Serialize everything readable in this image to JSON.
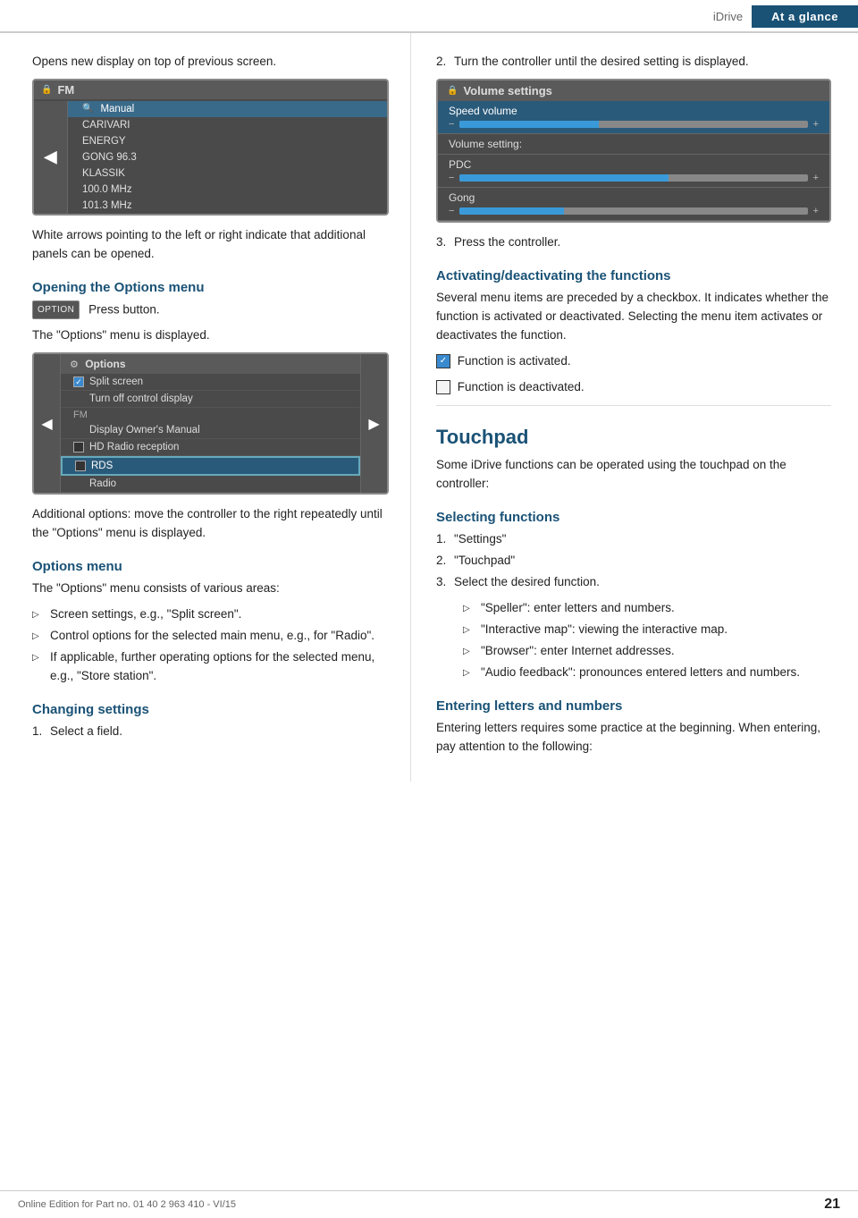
{
  "header": {
    "idrive_label": "iDrive",
    "ataglance_label": "At a glance"
  },
  "left_col": {
    "para1": "Opens new display on top of previous screen.",
    "screen1": {
      "header": "FM",
      "rows": [
        {
          "label": "Manual",
          "type": "search"
        },
        {
          "label": "CARIVARI",
          "type": "normal"
        },
        {
          "label": "ENERGY",
          "type": "normal"
        },
        {
          "label": "GONG 96.3",
          "type": "normal"
        },
        {
          "label": "KLASSIK",
          "type": "normal"
        },
        {
          "label": "100.0  MHz",
          "type": "normal"
        },
        {
          "label": "101.3  MHz",
          "type": "normal"
        }
      ]
    },
    "para2": "White arrows pointing to the left or right indicate that additional panels can be opened.",
    "opening_options": {
      "heading": "Opening the Options menu",
      "btn_label": "OPTION",
      "step": "Press button.",
      "result": "The \"Options\" menu is displayed."
    },
    "options_screen": {
      "header": "Options",
      "items": [
        {
          "label": "Split screen",
          "chk": true,
          "type": "checkbox"
        },
        {
          "label": "Turn off control display",
          "type": "normal"
        },
        {
          "label": "FM",
          "type": "section"
        },
        {
          "label": "Display Owner's Manual",
          "type": "normal"
        },
        {
          "label": "HD Radio reception",
          "chk": false,
          "type": "checkbox"
        },
        {
          "label": "RDS",
          "chk": false,
          "type": "checkbox",
          "highlighted": true
        },
        {
          "label": "Radio",
          "type": "normal"
        }
      ]
    },
    "additional_options_para": "Additional options: move the controller to the right repeatedly until the \"Options\" menu is displayed.",
    "options_menu": {
      "heading": "Options menu",
      "para": "The \"Options\" menu consists of various areas:",
      "items": [
        "Screen settings, e.g., \"Split screen\".",
        "Control options for the selected main menu, e.g., for \"Radio\".",
        "If applicable, further operating options for the selected menu, e.g., \"Store station\"."
      ]
    },
    "changing_settings": {
      "heading": "Changing settings",
      "step1": "Select a field."
    }
  },
  "right_col": {
    "step2": {
      "num": "2.",
      "text": "Turn the controller until the desired setting is displayed."
    },
    "vol_screen": {
      "header": "Volume settings",
      "speed_volume": {
        "label": "Speed volume",
        "fill_pct": 40
      },
      "volume_setting_label": "Volume setting:",
      "items": [
        {
          "label": "PDC",
          "fill_pct": 60
        },
        {
          "label": "Gong",
          "fill_pct": 30
        }
      ]
    },
    "step3": {
      "num": "3.",
      "text": "Press the controller."
    },
    "activating": {
      "heading": "Activating/deactivating the functions",
      "para": "Several menu items are preceded by a checkbox. It indicates whether the function is activated or deactivated. Selecting the menu item activates or deactivates the function.",
      "activated_label": "Function is activated.",
      "deactivated_label": "Function is deactivated."
    },
    "touchpad": {
      "heading": "Touchpad",
      "para": "Some iDrive functions can be operated using the touchpad on the controller:",
      "selecting": {
        "heading": "Selecting functions",
        "steps": [
          {
            "num": "1.",
            "text": "\"Settings\""
          },
          {
            "num": "2.",
            "text": "\"Touchpad\""
          },
          {
            "num": "3.",
            "text": "Select the desired function."
          }
        ],
        "substeps": [
          "\"Speller\": enter letters and numbers.",
          "\"Interactive map\": viewing the interactive map.",
          "\"Browser\": enter Internet addresses.",
          "\"Audio feedback\": pronounces entered letters and numbers."
        ]
      },
      "entering": {
        "heading": "Entering letters and numbers",
        "para": "Entering letters requires some practice at the beginning. When entering, pay attention to the following:"
      }
    }
  },
  "footer": {
    "online_text": "Online Edition for Part no. 01 40 2 963 410 - VI/15",
    "page_num": "21"
  }
}
